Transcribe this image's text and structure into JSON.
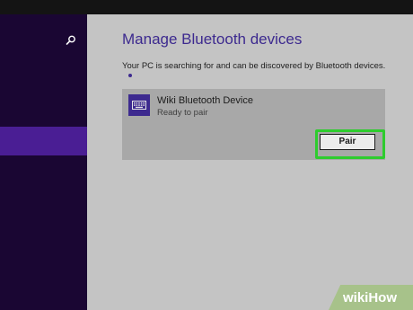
{
  "window": {
    "title": "Manage Bluetooth devices",
    "subtitle": "Your PC is searching for and can be discovered by Bluetooth devices."
  },
  "sidebar": {
    "search_icon": "search-icon",
    "selected_item_icon": "none"
  },
  "device": {
    "name": "Wiki Bluetooth Device",
    "status": "Ready to pair",
    "icon": "keyboard-icon",
    "pair_label": "Pair"
  },
  "colors": {
    "accent": "#3d2a8f",
    "sidebar_bg": "#1a0633",
    "sidebar_selected": "#4a1e94",
    "highlight": "#2ecc2e"
  },
  "watermark": {
    "text": "wikiHow"
  }
}
